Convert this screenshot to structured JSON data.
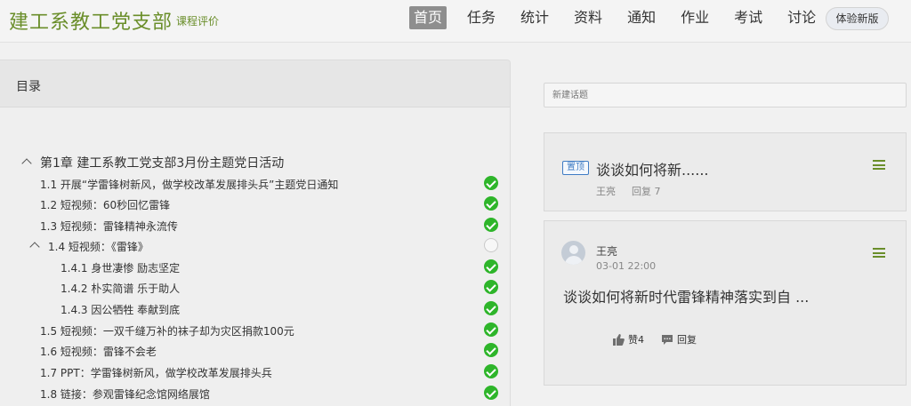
{
  "header": {
    "course_title": "建工系教工党支部",
    "course_eval": "课程评价",
    "nav": [
      "首页",
      "任务",
      "统计",
      "资料",
      "通知",
      "作业",
      "考试",
      "讨论"
    ],
    "active_nav": "首页",
    "new_version": "体验新版"
  },
  "toc": {
    "title": "目录",
    "chapter": "第1章 建工系教工党支部3月份主题党日活动",
    "items": [
      {
        "text": "1.1  开展“学雷锋树新风，做学校改革发展排头兵”主题党日通知",
        "status": "done"
      },
      {
        "text": "1.2  短视频：60秒回忆雷锋",
        "status": "done"
      },
      {
        "text": "1.3  短视频：雷锋精神永流传",
        "status": "done"
      },
      {
        "text": "1.4  短视频：《雷锋》",
        "status": "pending"
      },
      {
        "text": "1.4.1 身世凄惨 励志坚定",
        "status": "done"
      },
      {
        "text": "1.4.2 朴实简谱 乐于助人",
        "status": "done"
      },
      {
        "text": "1.4.3 因公牺牲 奉献到底",
        "status": "done"
      },
      {
        "text": "1.5  短视频：一双千缝万补的袜子却为灾区捐款100元",
        "status": "done"
      },
      {
        "text": "1.6  短视频：雷锋不会老",
        "status": "done"
      },
      {
        "text": "1.7  PPT：学雷锋树新风，做学校改革发展排头兵",
        "status": "done"
      },
      {
        "text": "1.8  链接：参观雷锋纪念馆网络展馆",
        "status": "done"
      }
    ]
  },
  "discussion": {
    "new_topic_placeholder": "新建话题",
    "pinned": {
      "badge": "置顶",
      "title": "谈谈如何将新......",
      "author": "王亮",
      "replies": "回复 7"
    },
    "post": {
      "author": "王亮",
      "time": "03-01 22:00",
      "body": "谈谈如何将新时代雷锋精神落实到自 ...",
      "like": "赞4",
      "reply": "回复"
    }
  },
  "icons": {
    "done": "check-circle-icon",
    "pending": "empty-circle-icon",
    "menu": "hamburger-menu-icon",
    "like": "thumbs-up-icon",
    "reply": "comment-icon"
  },
  "colors": {
    "brand_green": "#6a8e2a",
    "check_green": "#2eb52a",
    "pin_blue": "#3f7cc4"
  }
}
